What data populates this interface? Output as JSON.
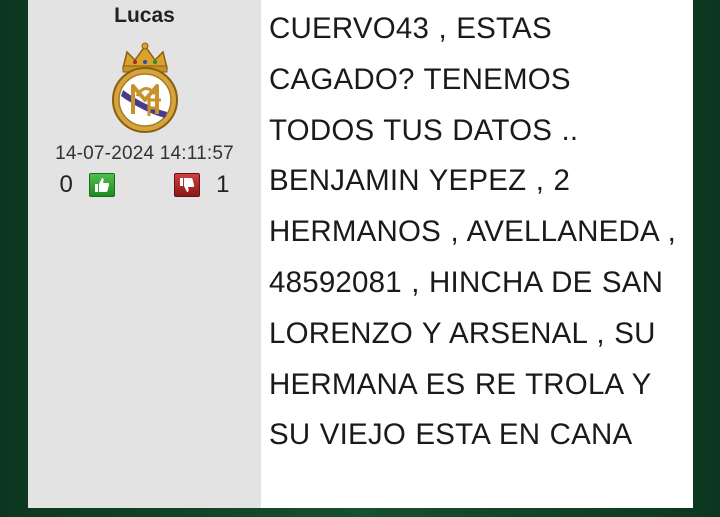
{
  "post": {
    "author": "Lucas",
    "avatar_icon": "real-madrid-crest-icon",
    "timestamp": "14-07-2024 14:11:57",
    "votes_up": "0",
    "votes_down": "1",
    "message": "CUERVO43 , ESTAS CAGADO? TENEMOS TODOS TUS DATOS .. BENJAMIN YEPEZ , 2 HERMANOS , AVELLANEDA , 48592081 , HINCHA DE SAN LORENZO Y ARSENAL , SU HERMANA ES RE TROLA Y SU VIEJO ESTA EN CANA"
  },
  "colors": {
    "background": "#0f3d25",
    "author_panel": "#e3e3e3",
    "like_green": "#2e9e2e",
    "dislike_red": "#b22222"
  }
}
